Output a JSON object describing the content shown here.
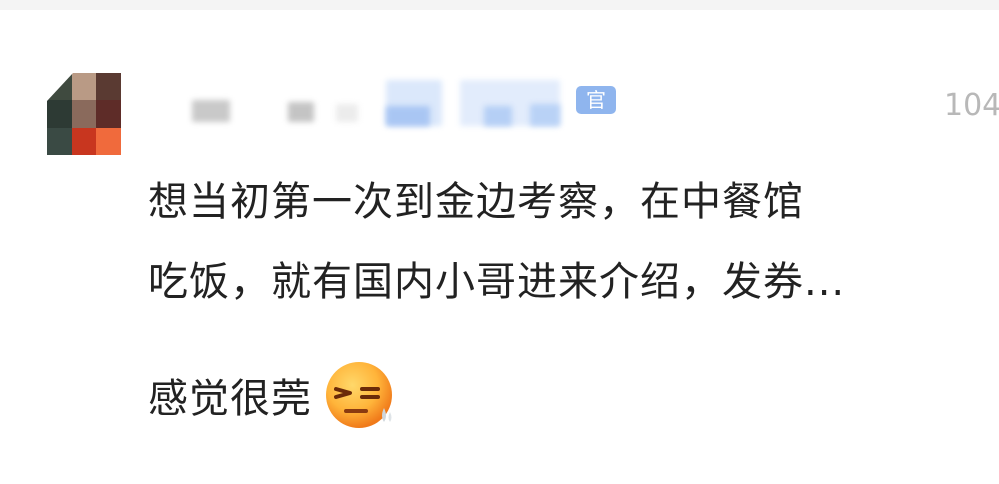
{
  "comment": {
    "username_badge": "官",
    "timestamp": "104",
    "body_lines": [
      "想当初第一次到金边考察，在中餐馆",
      "吃饭，就有国内小哥进来介绍，发券..."
    ],
    "reply_text": "感觉很莞",
    "emoji_icon": "squinting-sweat-face-icon",
    "colors": {
      "timestamp": "#b8b8b8",
      "text": "#222222",
      "badge": "#8fb5ee"
    }
  }
}
